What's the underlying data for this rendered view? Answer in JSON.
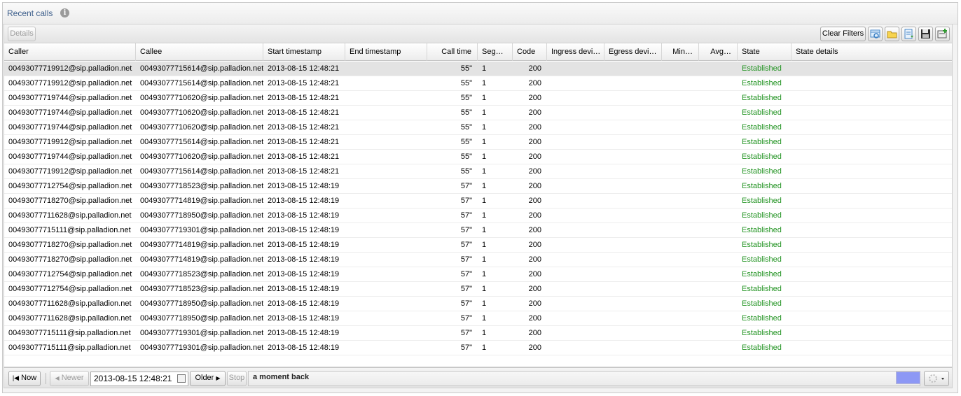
{
  "panel": {
    "title": "Recent calls",
    "info_icon": "info-icon"
  },
  "toolbar": {
    "details_label": "Details",
    "clear_filters_label": "Clear Filters",
    "icons": [
      "refresh-columns-icon",
      "open-folder-icon",
      "export-icon",
      "save-disk-icon",
      "add-filter-icon"
    ]
  },
  "columns": [
    "Caller",
    "Callee",
    "Start timestamp",
    "End timestamp",
    "Call time",
    "Seg…",
    "Code",
    "Ingress devi…",
    "Egress devi…",
    "Min…",
    "Avg…",
    "State",
    "State details"
  ],
  "rows": [
    {
      "caller": "00493077719912@sip.palladion.net",
      "callee": "00493077715614@sip.palladion.net",
      "start": "2013-08-15 12:48:21",
      "end": "",
      "call_time": "55\"",
      "seg": "1",
      "code": "200",
      "ingress": "",
      "egress": "",
      "min": "",
      "avg": "",
      "state": "Established",
      "details": ""
    },
    {
      "caller": "00493077719912@sip.palladion.net",
      "callee": "00493077715614@sip.palladion.net",
      "start": "2013-08-15 12:48:21",
      "end": "",
      "call_time": "55\"",
      "seg": "1",
      "code": "200",
      "ingress": "",
      "egress": "",
      "min": "",
      "avg": "",
      "state": "Established",
      "details": ""
    },
    {
      "caller": "00493077719744@sip.palladion.net",
      "callee": "00493077710620@sip.palladion.net",
      "start": "2013-08-15 12:48:21",
      "end": "",
      "call_time": "55\"",
      "seg": "1",
      "code": "200",
      "ingress": "",
      "egress": "",
      "min": "",
      "avg": "",
      "state": "Established",
      "details": ""
    },
    {
      "caller": "00493077719744@sip.palladion.net",
      "callee": "00493077710620@sip.palladion.net",
      "start": "2013-08-15 12:48:21",
      "end": "",
      "call_time": "55\"",
      "seg": "1",
      "code": "200",
      "ingress": "",
      "egress": "",
      "min": "",
      "avg": "",
      "state": "Established",
      "details": ""
    },
    {
      "caller": "00493077719744@sip.palladion.net",
      "callee": "00493077710620@sip.palladion.net",
      "start": "2013-08-15 12:48:21",
      "end": "",
      "call_time": "55\"",
      "seg": "1",
      "code": "200",
      "ingress": "",
      "egress": "",
      "min": "",
      "avg": "",
      "state": "Established",
      "details": ""
    },
    {
      "caller": "00493077719912@sip.palladion.net",
      "callee": "00493077715614@sip.palladion.net",
      "start": "2013-08-15 12:48:21",
      "end": "",
      "call_time": "55\"",
      "seg": "1",
      "code": "200",
      "ingress": "",
      "egress": "",
      "min": "",
      "avg": "",
      "state": "Established",
      "details": ""
    },
    {
      "caller": "00493077719744@sip.palladion.net",
      "callee": "00493077710620@sip.palladion.net",
      "start": "2013-08-15 12:48:21",
      "end": "",
      "call_time": "55\"",
      "seg": "1",
      "code": "200",
      "ingress": "",
      "egress": "",
      "min": "",
      "avg": "",
      "state": "Established",
      "details": ""
    },
    {
      "caller": "00493077719912@sip.palladion.net",
      "callee": "00493077715614@sip.palladion.net",
      "start": "2013-08-15 12:48:21",
      "end": "",
      "call_time": "55\"",
      "seg": "1",
      "code": "200",
      "ingress": "",
      "egress": "",
      "min": "",
      "avg": "",
      "state": "Established",
      "details": ""
    },
    {
      "caller": "00493077712754@sip.palladion.net",
      "callee": "00493077718523@sip.palladion.net",
      "start": "2013-08-15 12:48:19",
      "end": "",
      "call_time": "57\"",
      "seg": "1",
      "code": "200",
      "ingress": "",
      "egress": "",
      "min": "",
      "avg": "",
      "state": "Established",
      "details": ""
    },
    {
      "caller": "00493077718270@sip.palladion.net",
      "callee": "00493077714819@sip.palladion.net",
      "start": "2013-08-15 12:48:19",
      "end": "",
      "call_time": "57\"",
      "seg": "1",
      "code": "200",
      "ingress": "",
      "egress": "",
      "min": "",
      "avg": "",
      "state": "Established",
      "details": ""
    },
    {
      "caller": "00493077711628@sip.palladion.net",
      "callee": "00493077718950@sip.palladion.net",
      "start": "2013-08-15 12:48:19",
      "end": "",
      "call_time": "57\"",
      "seg": "1",
      "code": "200",
      "ingress": "",
      "egress": "",
      "min": "",
      "avg": "",
      "state": "Established",
      "details": ""
    },
    {
      "caller": "00493077715111@sip.palladion.net",
      "callee": "00493077719301@sip.palladion.net",
      "start": "2013-08-15 12:48:19",
      "end": "",
      "call_time": "57\"",
      "seg": "1",
      "code": "200",
      "ingress": "",
      "egress": "",
      "min": "",
      "avg": "",
      "state": "Established",
      "details": ""
    },
    {
      "caller": "00493077718270@sip.palladion.net",
      "callee": "00493077714819@sip.palladion.net",
      "start": "2013-08-15 12:48:19",
      "end": "",
      "call_time": "57\"",
      "seg": "1",
      "code": "200",
      "ingress": "",
      "egress": "",
      "min": "",
      "avg": "",
      "state": "Established",
      "details": ""
    },
    {
      "caller": "00493077718270@sip.palladion.net",
      "callee": "00493077714819@sip.palladion.net",
      "start": "2013-08-15 12:48:19",
      "end": "",
      "call_time": "57\"",
      "seg": "1",
      "code": "200",
      "ingress": "",
      "egress": "",
      "min": "",
      "avg": "",
      "state": "Established",
      "details": ""
    },
    {
      "caller": "00493077712754@sip.palladion.net",
      "callee": "00493077718523@sip.palladion.net",
      "start": "2013-08-15 12:48:19",
      "end": "",
      "call_time": "57\"",
      "seg": "1",
      "code": "200",
      "ingress": "",
      "egress": "",
      "min": "",
      "avg": "",
      "state": "Established",
      "details": ""
    },
    {
      "caller": "00493077712754@sip.palladion.net",
      "callee": "00493077718523@sip.palladion.net",
      "start": "2013-08-15 12:48:19",
      "end": "",
      "call_time": "57\"",
      "seg": "1",
      "code": "200",
      "ingress": "",
      "egress": "",
      "min": "",
      "avg": "",
      "state": "Established",
      "details": ""
    },
    {
      "caller": "00493077711628@sip.palladion.net",
      "callee": "00493077718950@sip.palladion.net",
      "start": "2013-08-15 12:48:19",
      "end": "",
      "call_time": "57\"",
      "seg": "1",
      "code": "200",
      "ingress": "",
      "egress": "",
      "min": "",
      "avg": "",
      "state": "Established",
      "details": ""
    },
    {
      "caller": "00493077711628@sip.palladion.net",
      "callee": "00493077718950@sip.palladion.net",
      "start": "2013-08-15 12:48:19",
      "end": "",
      "call_time": "57\"",
      "seg": "1",
      "code": "200",
      "ingress": "",
      "egress": "",
      "min": "",
      "avg": "",
      "state": "Established",
      "details": ""
    },
    {
      "caller": "00493077715111@sip.palladion.net",
      "callee": "00493077719301@sip.palladion.net",
      "start": "2013-08-15 12:48:19",
      "end": "",
      "call_time": "57\"",
      "seg": "1",
      "code": "200",
      "ingress": "",
      "egress": "",
      "min": "",
      "avg": "",
      "state": "Established",
      "details": ""
    },
    {
      "caller": "00493077715111@sip.palladion.net",
      "callee": "00493077719301@sip.palladion.net",
      "start": "2013-08-15 12:48:19",
      "end": "",
      "call_time": "57\"",
      "seg": "1",
      "code": "200",
      "ingress": "",
      "egress": "",
      "min": "",
      "avg": "",
      "state": "Established",
      "details": ""
    }
  ],
  "selected_row": 0,
  "pager": {
    "now_label": "Now",
    "newer_label": "Newer",
    "date_value": "2013-08-15 12:48:21",
    "older_label": "Older",
    "stop_label": "Stop",
    "status_text": "a moment back",
    "progress": 1.0
  },
  "colors": {
    "state_established": "#219321",
    "title": "#3b5d8a",
    "progress_fill": "#8d98f5"
  }
}
